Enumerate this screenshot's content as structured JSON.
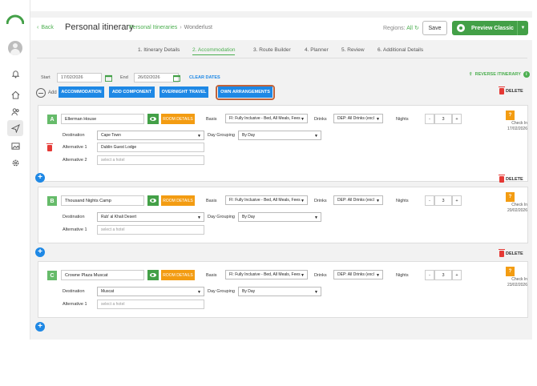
{
  "header": {
    "back": "Back",
    "title": "Personal itinerary",
    "breadcrumb_link": "Personal Itineraries",
    "breadcrumb_current": "Wonderlust",
    "regions_label": "Regions:",
    "regions_value": "All",
    "save": "Save",
    "preview": "Preview Classic"
  },
  "steps": [
    "1. Itinerary Details",
    "2. Accommodation",
    "3. Route Builder",
    "4. Planner",
    "5. Review",
    "6. Additional Details"
  ],
  "dates": {
    "start_label": "Start",
    "start_value": "17/02/2026",
    "end_label": "End",
    "end_value": "26/02/2026",
    "clear": "CLEAR DATES"
  },
  "reverse": "REVERSE ITINERARY",
  "add": {
    "label": "Add",
    "buttons": [
      "ACCOMMODATION",
      "ADD COMPONENT",
      "OVERNIGHT TRAVEL",
      "OWN ARRANGEMENTS"
    ]
  },
  "delete": "DELETE",
  "labels": {
    "room_details": "ROOM DETAILS",
    "basis": "Basis",
    "drinks": "Drinks",
    "nights": "Nights",
    "destination": "Destination",
    "day_grouping": "Day Grouping",
    "alternative1": "Alternative 1",
    "alternative2": "Alternative 2",
    "check_in": "Check In",
    "placeholder": "select a hotel"
  },
  "cards": [
    {
      "letter": "A",
      "hotel": "Ellerman House",
      "basis": "FI: Fully Inclusive - Bed, All Meals, Fees",
      "drinks": "DEP: All Drinks (excl",
      "nights": "3",
      "destination": "Cape Town",
      "day_grouping": "By Day",
      "alternative1": "Dublin Guest Lodge",
      "check_in": "17/02/2026"
    },
    {
      "letter": "B",
      "hotel": "Thousand Nights Camp",
      "basis": "FI: Fully Inclusive - Bed, All Meals, Fees",
      "drinks": "DEP: All Drinks (excl",
      "nights": "3",
      "destination": "Rub' al Khali Desert",
      "day_grouping": "By Day",
      "check_in": "20/02/2026"
    },
    {
      "letter": "C",
      "hotel": "Crowne Plaza Muscat",
      "basis": "FI: Fully Inclusive - Bed, All Meals, Fees",
      "drinks": "DEP: All Drinks (excl",
      "nights": "3",
      "destination": "Muscat",
      "day_grouping": "By Day",
      "check_in": "23/02/2026"
    }
  ]
}
